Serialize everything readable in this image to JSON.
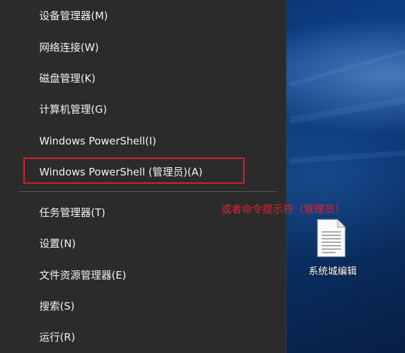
{
  "menu": {
    "items": [
      {
        "label": "设备管理器(M)"
      },
      {
        "label": "网络连接(W)"
      },
      {
        "label": "磁盘管理(K)"
      },
      {
        "label": "计算机管理(G)"
      },
      {
        "label": "Windows PowerShell(I)"
      },
      {
        "label": "Windows PowerShell (管理员)(A)"
      },
      {
        "label": "任务管理器(T)"
      },
      {
        "label": "设置(N)"
      },
      {
        "label": "文件资源管理器(E)"
      },
      {
        "label": "搜索(S)"
      },
      {
        "label": "运行(R)"
      }
    ]
  },
  "annotation": {
    "text": "或者命令提示符（管理员）",
    "color": "#e2222f"
  },
  "desktop": {
    "file_label": "系统城编辑",
    "file_icon": "document-icon"
  }
}
